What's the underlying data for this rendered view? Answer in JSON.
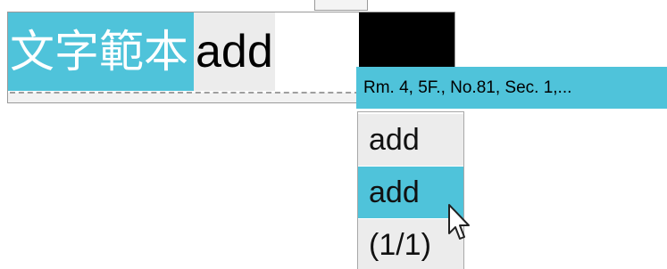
{
  "composition": {
    "selected_text": "文字範本",
    "typed_text": "add"
  },
  "tooltip": {
    "text": "Rm. 4, 5F., No.81, Sec. 1,..."
  },
  "candidates": {
    "items": [
      {
        "label": "add",
        "selected": false
      },
      {
        "label": "add",
        "selected": true
      }
    ],
    "page_indicator": "(1/1)"
  },
  "colors": {
    "highlight": "#4fc3da",
    "candidate_bg": "#ececec",
    "caret": "#000000"
  },
  "icons": {
    "cursor": "mouse-pointer-icon"
  }
}
